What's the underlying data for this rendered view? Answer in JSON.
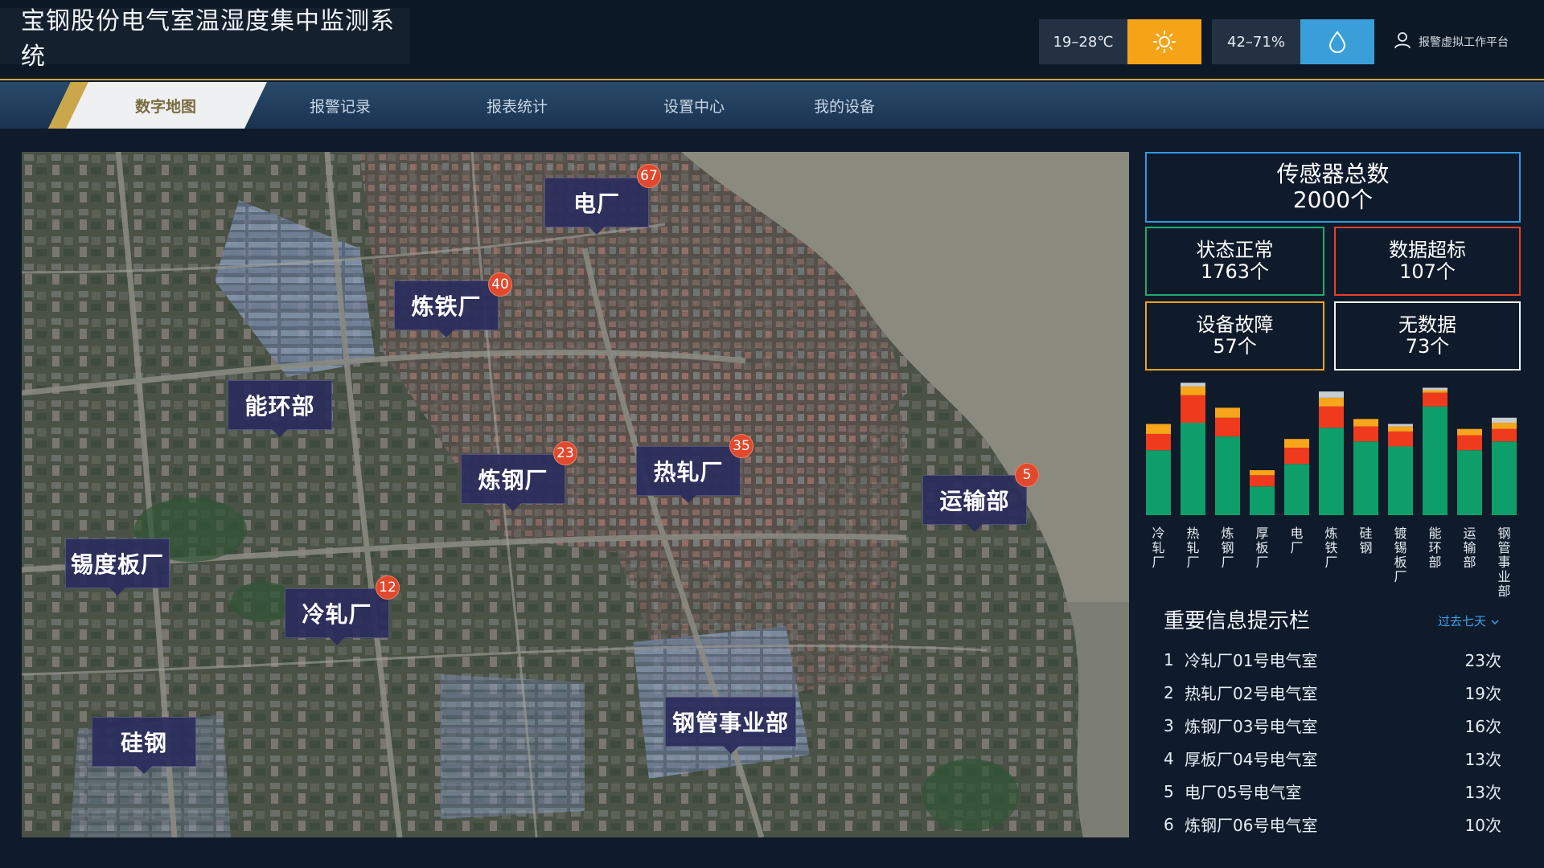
{
  "header": {
    "title": "宝钢股份电气室温湿度集中监测系统",
    "temperature": "19–28℃",
    "humidity": "42–71%",
    "temp_icon": "sun-icon",
    "humidity_icon": "water-drop-icon",
    "user_icon": "user-icon",
    "user_label": "报警虚拟工作平台"
  },
  "nav": {
    "items": [
      {
        "label": "数字地图",
        "active": true
      },
      {
        "label": "报警记录"
      },
      {
        "label": "报表统计"
      },
      {
        "label": "设置中心"
      },
      {
        "label": "我的设备"
      }
    ]
  },
  "map": {
    "markers": [
      {
        "label": "电厂",
        "badge": "67"
      },
      {
        "label": "炼铁厂",
        "badge": "40"
      },
      {
        "label": "能环部"
      },
      {
        "label": "炼钢厂",
        "badge": "23"
      },
      {
        "label": "热轧厂",
        "badge": "35"
      },
      {
        "label": "运输部",
        "badge": "5"
      },
      {
        "label": "锡度板厂"
      },
      {
        "label": "冷轧厂",
        "badge": "12"
      },
      {
        "label": "钢管事业部"
      },
      {
        "label": "硅钢"
      }
    ]
  },
  "stats": {
    "total_label": "传感器总数",
    "total_value": "2000个",
    "normal_label": "状态正常",
    "normal_value": "1763个",
    "over_label": "数据超标",
    "over_value": "107个",
    "fault_label": "设备故障",
    "fault_value": "57个",
    "nodata_label": "无数据",
    "nodata_value": "73个",
    "colors": {
      "normal": "#1faa6e",
      "over": "#e8402a",
      "fault": "#f5a317",
      "nodata": "#f2f2f2",
      "total": "#2f9ae0"
    }
  },
  "chart_data": {
    "type": "bar",
    "stacked": true,
    "categories": [
      "冷轧厂",
      "热轧厂",
      "炼钢厂",
      "厚板厂",
      "电厂",
      "炼铁厂",
      "硅钢",
      "镀锡板厂",
      "能环部",
      "运输部",
      "钢管事业部"
    ],
    "series": [
      {
        "values": [
          52,
          74,
          63,
          23,
          41,
          70,
          59,
          55,
          87,
          52,
          59
        ],
        "color": "#0e9e6a"
      },
      {
        "values": [
          13,
          22,
          15,
          9,
          13,
          17,
          12,
          12,
          11,
          12,
          10
        ],
        "color": "#ef3a1e"
      },
      {
        "values": [
          8,
          7,
          8,
          4,
          7,
          7,
          6,
          4,
          2,
          5,
          5
        ],
        "color": "#f7a51a"
      },
      {
        "values": [
          0,
          3,
          0,
          0,
          0,
          5,
          0,
          2,
          2,
          0,
          4
        ],
        "color": "#c8cdd2"
      }
    ],
    "ylim": [
      0,
      110
    ],
    "grid": false,
    "legend": "none"
  },
  "info": {
    "title": "重要信息提示栏",
    "filter_label": "过去七天",
    "filter_icon": "chevron-down-icon",
    "items": [
      {
        "num": "1",
        "name": "冷轧厂01号电气室",
        "count": "23次"
      },
      {
        "num": "2",
        "name": "热轧厂02号电气室",
        "count": "19次"
      },
      {
        "num": "3",
        "name": "炼钢厂03号电气室",
        "count": "16次"
      },
      {
        "num": "4",
        "name": "厚板厂04号电气室",
        "count": "13次"
      },
      {
        "num": "5",
        "name": "电厂05号电气室",
        "count": "13次"
      },
      {
        "num": "6",
        "name": "炼钢厂06号电气室",
        "count": "10次"
      }
    ]
  }
}
